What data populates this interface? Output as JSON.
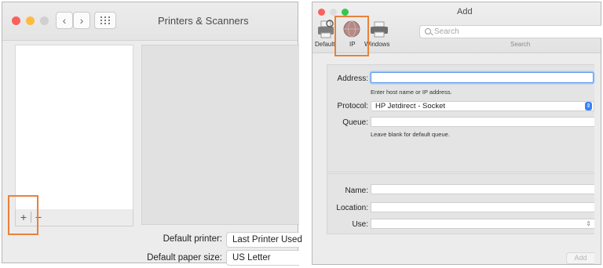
{
  "left_window": {
    "title": "Printers & Scanners",
    "add_label": "+",
    "remove_label": "−",
    "default_printer_label": "Default printer:",
    "default_printer_value": "Last Printer Used",
    "paper_size_label": "Default paper size:",
    "paper_size_value": "US Letter"
  },
  "right_window": {
    "title": "Add",
    "toolbar": {
      "default_label": "Default",
      "ip_label": "IP",
      "windows_label": "Windows",
      "search_placeholder": "Search",
      "search_caption": "Search"
    },
    "form": {
      "address_label": "Address:",
      "address_value": "",
      "address_hint": "Enter host name or IP address.",
      "protocol_label": "Protocol:",
      "protocol_value": "HP Jetdirect - Socket",
      "queue_label": "Queue:",
      "queue_value": "",
      "queue_hint": "Leave blank for default queue.",
      "name_label": "Name:",
      "name_value": "",
      "location_label": "Location:",
      "location_value": "",
      "use_label": "Use:",
      "use_value": ""
    },
    "add_button_label": "Add"
  },
  "colors": {
    "highlight": "#e8823a",
    "focus_ring": "#5a9bef",
    "traffic_red": "#fc605c",
    "traffic_yellow": "#fdbc40",
    "traffic_green": "#34c84a"
  }
}
